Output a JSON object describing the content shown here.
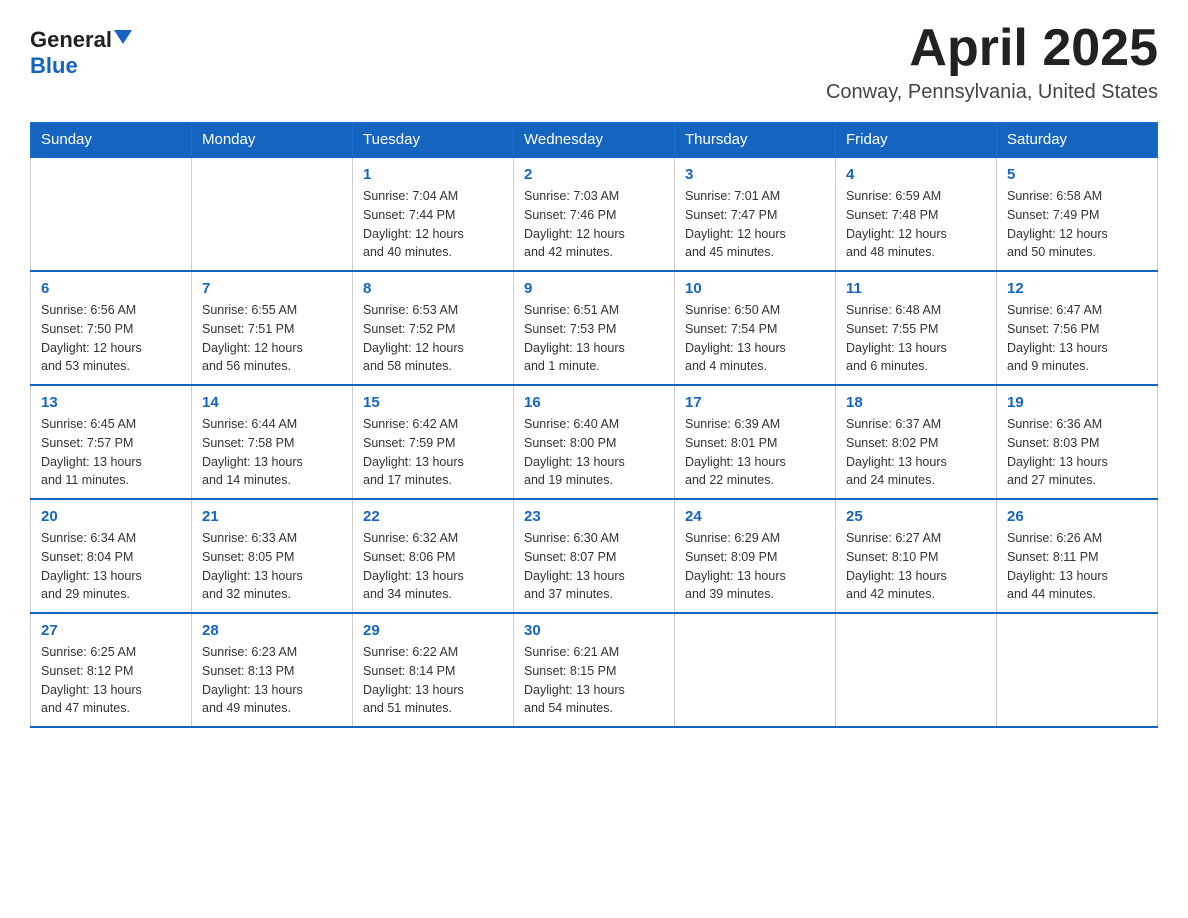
{
  "header": {
    "logo_line1": "General",
    "logo_line2": "Blue",
    "month_title": "April 2025",
    "subtitle": "Conway, Pennsylvania, United States"
  },
  "days_of_week": [
    "Sunday",
    "Monday",
    "Tuesday",
    "Wednesday",
    "Thursday",
    "Friday",
    "Saturday"
  ],
  "weeks": [
    [
      {
        "day": "",
        "info": ""
      },
      {
        "day": "",
        "info": ""
      },
      {
        "day": "1",
        "info": "Sunrise: 7:04 AM\nSunset: 7:44 PM\nDaylight: 12 hours\nand 40 minutes."
      },
      {
        "day": "2",
        "info": "Sunrise: 7:03 AM\nSunset: 7:46 PM\nDaylight: 12 hours\nand 42 minutes."
      },
      {
        "day": "3",
        "info": "Sunrise: 7:01 AM\nSunset: 7:47 PM\nDaylight: 12 hours\nand 45 minutes."
      },
      {
        "day": "4",
        "info": "Sunrise: 6:59 AM\nSunset: 7:48 PM\nDaylight: 12 hours\nand 48 minutes."
      },
      {
        "day": "5",
        "info": "Sunrise: 6:58 AM\nSunset: 7:49 PM\nDaylight: 12 hours\nand 50 minutes."
      }
    ],
    [
      {
        "day": "6",
        "info": "Sunrise: 6:56 AM\nSunset: 7:50 PM\nDaylight: 12 hours\nand 53 minutes."
      },
      {
        "day": "7",
        "info": "Sunrise: 6:55 AM\nSunset: 7:51 PM\nDaylight: 12 hours\nand 56 minutes."
      },
      {
        "day": "8",
        "info": "Sunrise: 6:53 AM\nSunset: 7:52 PM\nDaylight: 12 hours\nand 58 minutes."
      },
      {
        "day": "9",
        "info": "Sunrise: 6:51 AM\nSunset: 7:53 PM\nDaylight: 13 hours\nand 1 minute."
      },
      {
        "day": "10",
        "info": "Sunrise: 6:50 AM\nSunset: 7:54 PM\nDaylight: 13 hours\nand 4 minutes."
      },
      {
        "day": "11",
        "info": "Sunrise: 6:48 AM\nSunset: 7:55 PM\nDaylight: 13 hours\nand 6 minutes."
      },
      {
        "day": "12",
        "info": "Sunrise: 6:47 AM\nSunset: 7:56 PM\nDaylight: 13 hours\nand 9 minutes."
      }
    ],
    [
      {
        "day": "13",
        "info": "Sunrise: 6:45 AM\nSunset: 7:57 PM\nDaylight: 13 hours\nand 11 minutes."
      },
      {
        "day": "14",
        "info": "Sunrise: 6:44 AM\nSunset: 7:58 PM\nDaylight: 13 hours\nand 14 minutes."
      },
      {
        "day": "15",
        "info": "Sunrise: 6:42 AM\nSunset: 7:59 PM\nDaylight: 13 hours\nand 17 minutes."
      },
      {
        "day": "16",
        "info": "Sunrise: 6:40 AM\nSunset: 8:00 PM\nDaylight: 13 hours\nand 19 minutes."
      },
      {
        "day": "17",
        "info": "Sunrise: 6:39 AM\nSunset: 8:01 PM\nDaylight: 13 hours\nand 22 minutes."
      },
      {
        "day": "18",
        "info": "Sunrise: 6:37 AM\nSunset: 8:02 PM\nDaylight: 13 hours\nand 24 minutes."
      },
      {
        "day": "19",
        "info": "Sunrise: 6:36 AM\nSunset: 8:03 PM\nDaylight: 13 hours\nand 27 minutes."
      }
    ],
    [
      {
        "day": "20",
        "info": "Sunrise: 6:34 AM\nSunset: 8:04 PM\nDaylight: 13 hours\nand 29 minutes."
      },
      {
        "day": "21",
        "info": "Sunrise: 6:33 AM\nSunset: 8:05 PM\nDaylight: 13 hours\nand 32 minutes."
      },
      {
        "day": "22",
        "info": "Sunrise: 6:32 AM\nSunset: 8:06 PM\nDaylight: 13 hours\nand 34 minutes."
      },
      {
        "day": "23",
        "info": "Sunrise: 6:30 AM\nSunset: 8:07 PM\nDaylight: 13 hours\nand 37 minutes."
      },
      {
        "day": "24",
        "info": "Sunrise: 6:29 AM\nSunset: 8:09 PM\nDaylight: 13 hours\nand 39 minutes."
      },
      {
        "day": "25",
        "info": "Sunrise: 6:27 AM\nSunset: 8:10 PM\nDaylight: 13 hours\nand 42 minutes."
      },
      {
        "day": "26",
        "info": "Sunrise: 6:26 AM\nSunset: 8:11 PM\nDaylight: 13 hours\nand 44 minutes."
      }
    ],
    [
      {
        "day": "27",
        "info": "Sunrise: 6:25 AM\nSunset: 8:12 PM\nDaylight: 13 hours\nand 47 minutes."
      },
      {
        "day": "28",
        "info": "Sunrise: 6:23 AM\nSunset: 8:13 PM\nDaylight: 13 hours\nand 49 minutes."
      },
      {
        "day": "29",
        "info": "Sunrise: 6:22 AM\nSunset: 8:14 PM\nDaylight: 13 hours\nand 51 minutes."
      },
      {
        "day": "30",
        "info": "Sunrise: 6:21 AM\nSunset: 8:15 PM\nDaylight: 13 hours\nand 54 minutes."
      },
      {
        "day": "",
        "info": ""
      },
      {
        "day": "",
        "info": ""
      },
      {
        "day": "",
        "info": ""
      }
    ]
  ]
}
